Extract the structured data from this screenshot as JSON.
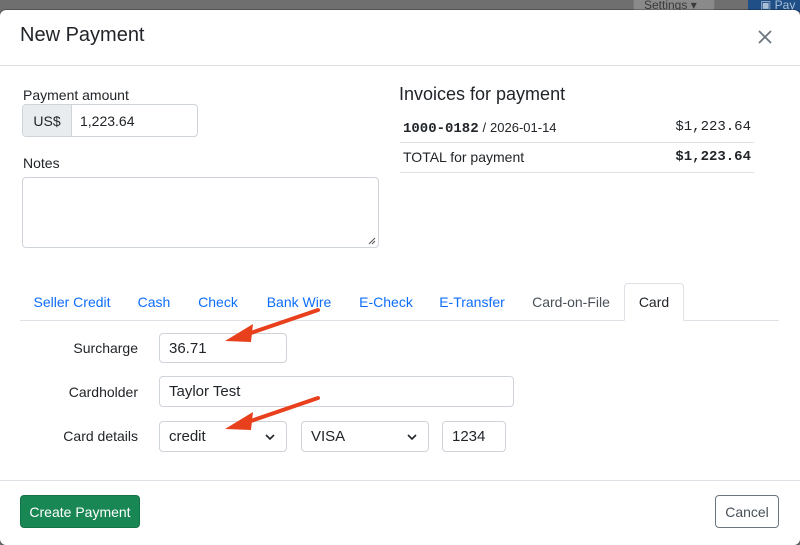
{
  "background": {
    "settings_label": "Settings",
    "blue_button_label": "Pay"
  },
  "modal": {
    "title": "New Payment",
    "close_icon": "close-icon"
  },
  "payment": {
    "amount_label": "Payment amount",
    "currency": "US$",
    "amount_value": "1,223.64",
    "notes_label": "Notes",
    "notes_value": ""
  },
  "invoices": {
    "title": "Invoices for payment",
    "rows": [
      {
        "number": "1000-0182",
        "separator": "/",
        "date": "2026-01-14",
        "amount": "$1,223.64"
      }
    ],
    "total_label": "TOTAL for payment",
    "total_amount": "$1,223.64"
  },
  "tabs": [
    {
      "label": "Seller Credit"
    },
    {
      "label": "Cash"
    },
    {
      "label": "Check"
    },
    {
      "label": "Bank Wire"
    },
    {
      "label": "E-Check"
    },
    {
      "label": "E-Transfer"
    },
    {
      "label": "Card-on-File"
    },
    {
      "label": "Card",
      "active": true
    }
  ],
  "card_form": {
    "surcharge_label": "Surcharge",
    "surcharge_value": "36.71",
    "cardholder_label": "Cardholder",
    "cardholder_value": "Taylor Test",
    "card_details_label": "Card details",
    "card_type_value": "credit",
    "card_brand_value": "VISA",
    "card_last4_value": "1234"
  },
  "footer": {
    "create_label": "Create Payment",
    "cancel_label": "Cancel"
  },
  "colors": {
    "link_blue": "#0d6efd",
    "create_green": "#198754",
    "annotation_arrow": "#e8401c"
  }
}
